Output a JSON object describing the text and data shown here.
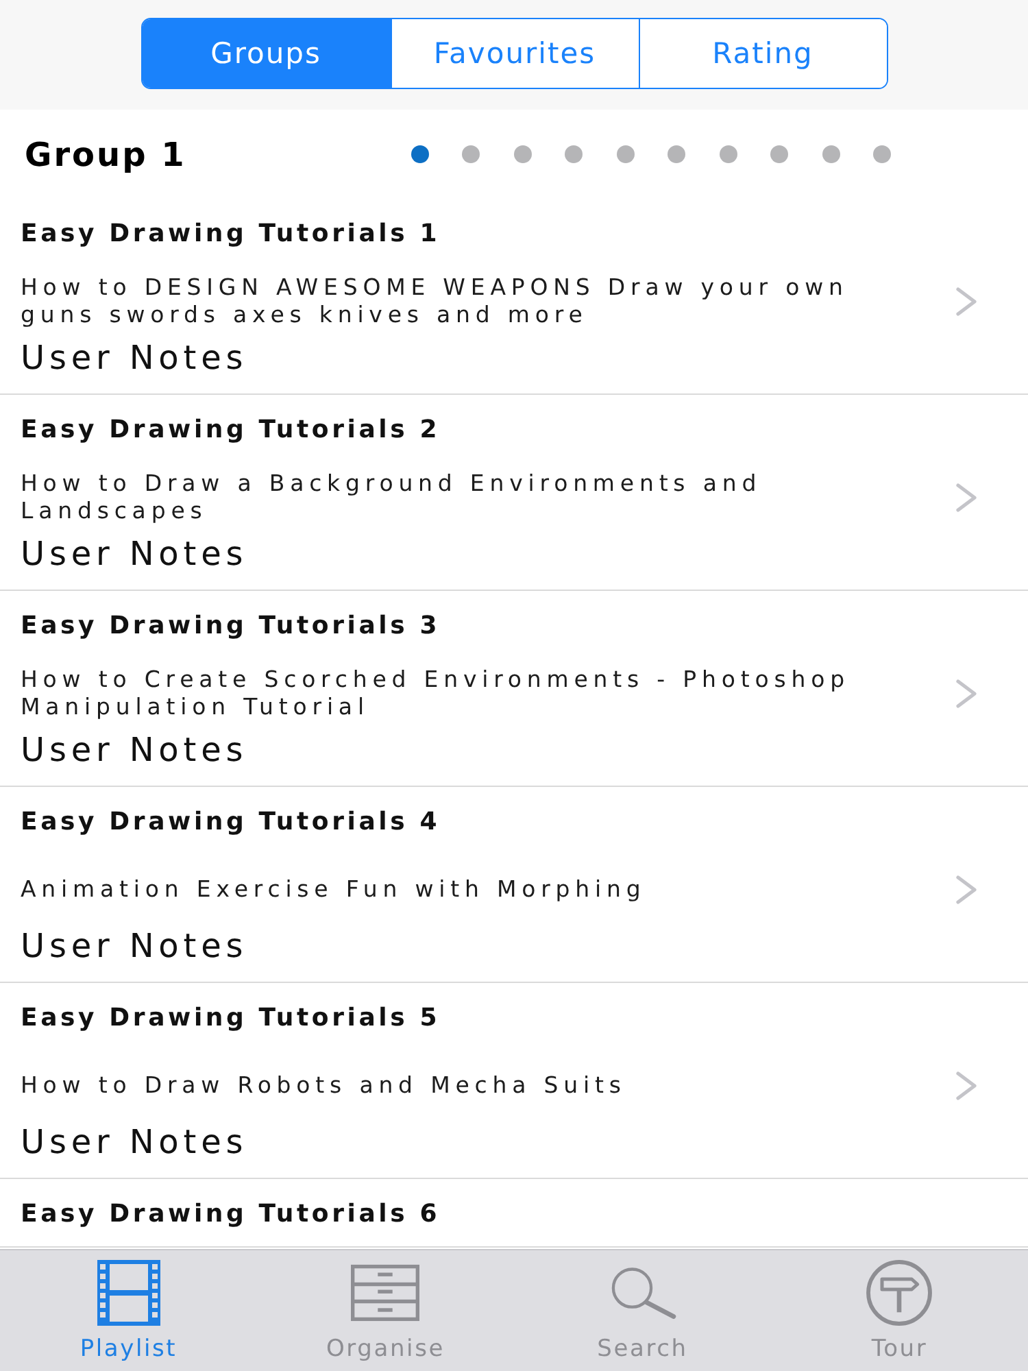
{
  "segments": [
    {
      "label": "Groups",
      "selected": true
    },
    {
      "label": "Favourites",
      "selected": false
    },
    {
      "label": "Rating",
      "selected": false
    }
  ],
  "group": {
    "title": "Group 1",
    "page_dots": [
      {
        "selected": true
      },
      {
        "selected": false
      },
      {
        "selected": false
      },
      {
        "selected": false
      },
      {
        "selected": false
      },
      {
        "selected": false
      },
      {
        "selected": false
      },
      {
        "selected": false
      },
      {
        "selected": false
      },
      {
        "selected": false
      }
    ]
  },
  "tutorials": [
    {
      "title": "Easy Drawing Tutorials 1",
      "subtitle": "How to DESIGN AWESOME WEAPONS Draw your own guns swords axes knives and more",
      "notes": "User Notes"
    },
    {
      "title": "Easy Drawing Tutorials 2",
      "subtitle": "How to Draw a Background Environments and Landscapes",
      "notes": "User Notes"
    },
    {
      "title": "Easy Drawing Tutorials 3",
      "subtitle": "How to Create Scorched Environments - Photoshop Manipulation Tutorial",
      "notes": "User Notes"
    },
    {
      "title": "Easy Drawing Tutorials 4",
      "subtitle": "Animation Exercise Fun with Morphing",
      "notes": "User Notes"
    },
    {
      "title": "Easy Drawing Tutorials 5",
      "subtitle": "How to Draw Robots and Mecha Suits",
      "notes": "User Notes"
    },
    {
      "title": "Easy Drawing Tutorials 6"
    }
  ],
  "tab_bar": [
    {
      "label": "Playlist",
      "selected": true
    },
    {
      "label": "Organise",
      "selected": false
    },
    {
      "label": "Search",
      "selected": false
    },
    {
      "label": "Tour",
      "selected": false
    }
  ]
}
